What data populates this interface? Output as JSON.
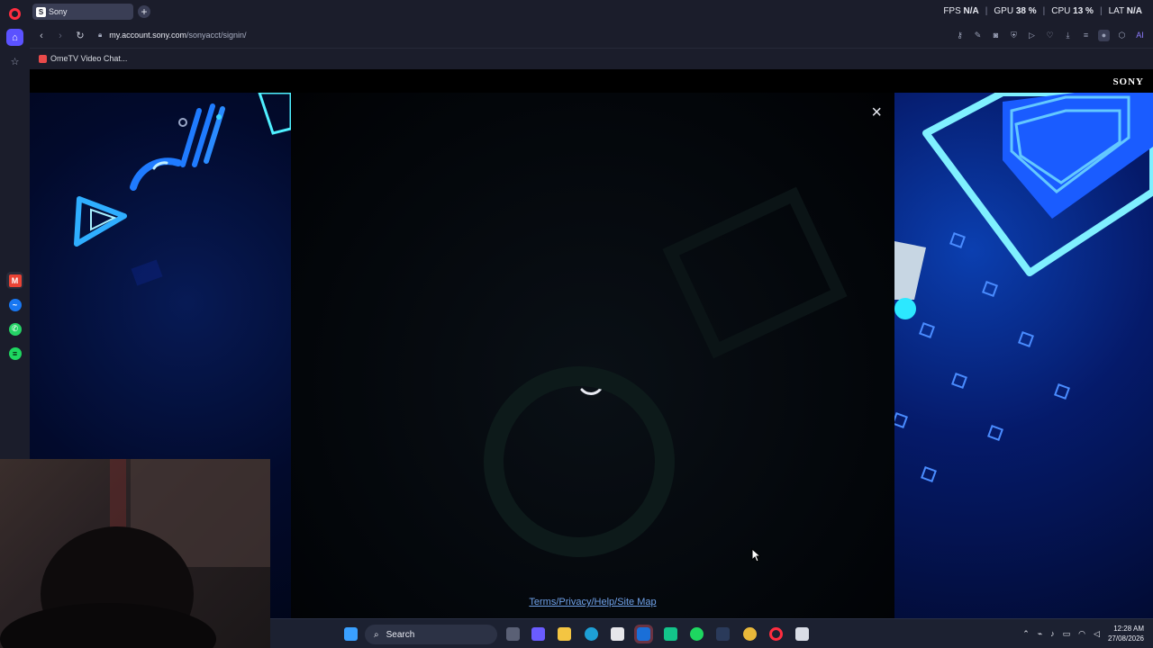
{
  "browser": {
    "tab_title": "Sony",
    "tab_favicon": "S",
    "new_tab_icon": "+",
    "perf": {
      "fps_label": "FPS",
      "fps_value": "N/A",
      "gpu_label": "GPU",
      "gpu_value": "38 %",
      "cpu_label": "CPU",
      "cpu_value": "13 %",
      "lat_label": "LAT",
      "lat_value": "N/A"
    },
    "url_host": "my.account.sony.com",
    "url_path": "/sonyacct/signin/",
    "bookmark": "OmeTV Video Chat...",
    "ai_label": "AI"
  },
  "page": {
    "brand": "SONY",
    "close_icon": "×",
    "footer_link": "Terms/Privacy/Help/Site Map"
  },
  "taskbar": {
    "search_label": "Search",
    "time": "12:28 AM",
    "date": "27/08/2026"
  },
  "colors": {
    "accent": "#5b52ff",
    "opera_red": "#ff2d3f",
    "link": "#6fa1e8"
  }
}
